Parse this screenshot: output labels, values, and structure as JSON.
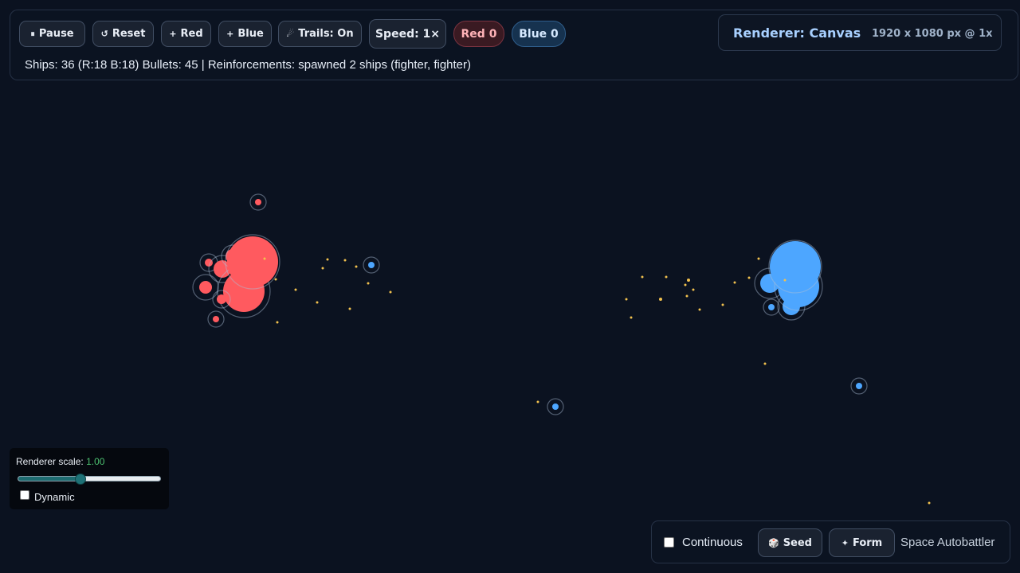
{
  "toolbar": {
    "pause": {
      "icon": "pause-icon",
      "glyph": "⏸",
      "label": "Pause"
    },
    "reset": {
      "icon": "reset-icon",
      "glyph": "↺",
      "label": "Reset"
    },
    "add_red": {
      "icon": "plus-icon",
      "glyph": "+",
      "label": "Red"
    },
    "add_blue": {
      "icon": "plus-icon",
      "glyph": "+",
      "label": "Blue"
    },
    "trails": {
      "icon": "comet-icon",
      "glyph": "☄",
      "label": "Trails: On"
    },
    "speed": {
      "label": "Speed: 1×"
    }
  },
  "scores": {
    "red": "Red 0",
    "blue": "Blue 0"
  },
  "status": "Ships: 36 (R:18 B:18) Bullets: 45 | Reinforcements: spawned 2 ships (fighter, fighter)",
  "renderer": {
    "title": "Renderer: Canvas",
    "resolution": "1920 x 1080 px @ 1x"
  },
  "scale_panel": {
    "label": "Renderer scale:",
    "value": "1.00",
    "slider_fraction": 0.44,
    "dynamic_label": "Dynamic",
    "dynamic_checked": false
  },
  "bottom_panel": {
    "continuous_label": "Continuous",
    "continuous_checked": false,
    "seed": {
      "icon": "dice-icon",
      "glyph": "🎲",
      "label": "Seed"
    },
    "form": {
      "icon": "formation-icon",
      "glyph": "✦",
      "label": "Form"
    },
    "app_title": "Space Autobattler"
  },
  "colors": {
    "background": "#0b1220",
    "red_team": "#ff5a5f",
    "blue_team": "#4da6ff",
    "bullet": "#f2c14e",
    "red_badge_bg": "#3a1a22",
    "blue_badge_bg": "#16324f"
  }
}
